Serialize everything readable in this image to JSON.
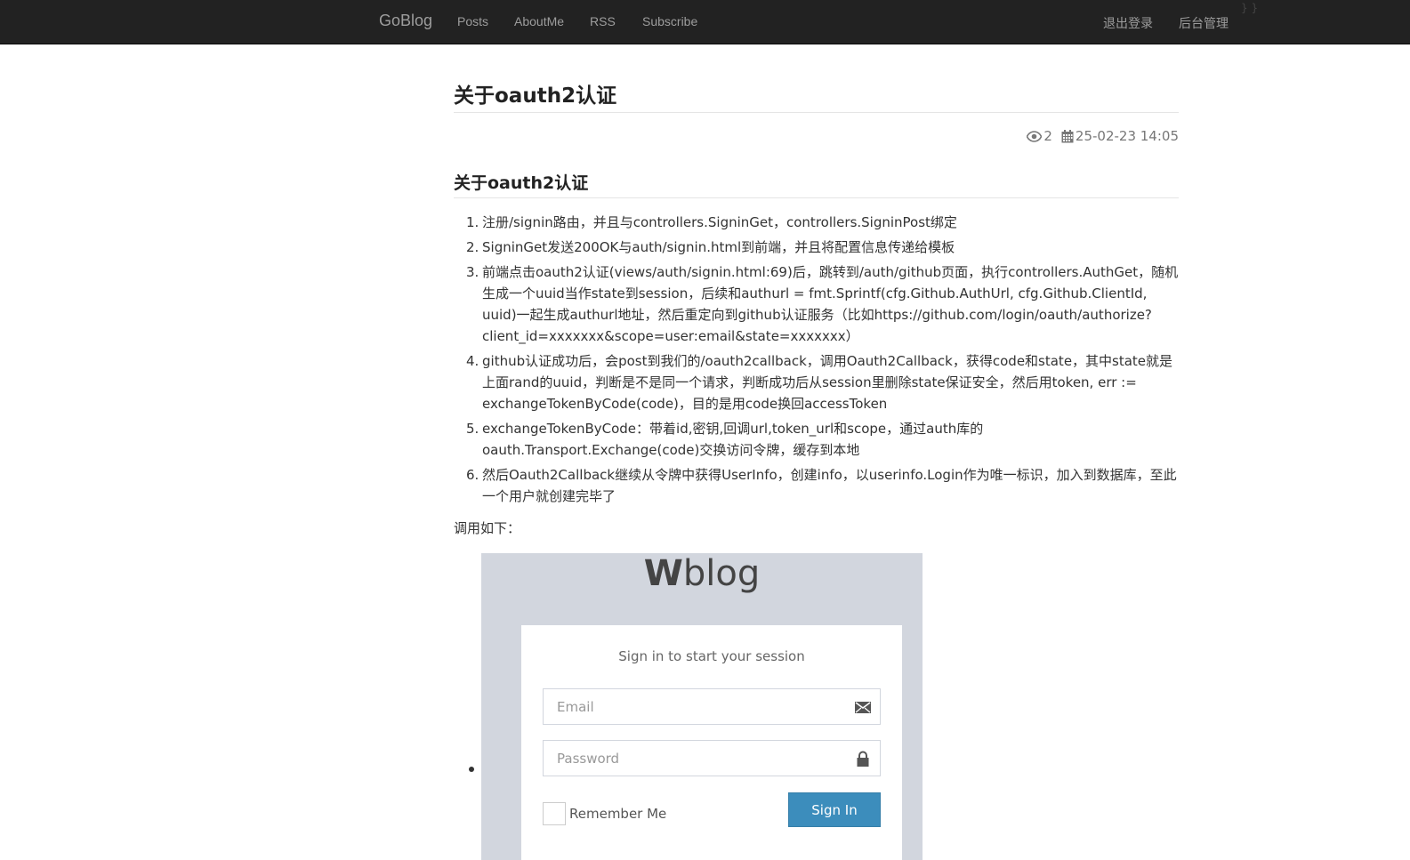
{
  "navbar": {
    "brand": "GoBlog",
    "links": [
      "Posts",
      "AboutMe",
      "RSS",
      "Subscribe"
    ],
    "right_links": [
      "退出登录",
      "后台管理"
    ],
    "ghost_text": "} }"
  },
  "post": {
    "title": "关于oauth2认证",
    "views": "2",
    "date": "25-02-23 14:05",
    "heading": "关于oauth2认证",
    "steps": [
      "注册/signin路由，并且与controllers.SigninGet，controllers.SigninPost绑定",
      "SigninGet发送200OK与auth/signin.html到前端，并且将配置信息传递给模板",
      "前端点击oauth2认证(views/auth/signin.html:69)后，跳转到/auth/github页面，执行controllers.AuthGet，随机生成一个uuid当作state到session，后续和authurl = fmt.Sprintf(cfg.Github.AuthUrl, cfg.Github.ClientId, uuid)一起生成authurl地址，然后重定向到github认证服务（比如https://github.com/login/oauth/authorize?client_id=xxxxxxx&scope=user:email&state=xxxxxxx）",
      "github认证成功后，会post到我们的/oauth2callback，调用Oauth2Callback，获得code和state，其中state就是上面rand的uuid，判断是不是同一个请求，判断成功后从session里删除state保证安全，然后用token, err := exchangeTokenByCode(code)，目的是用code换回accessToken",
      "exchangeTokenByCode：带着id,密钥,回调url,token_url和scope，通过auth库的oauth.Transport.Exchange(code)交换访问令牌，缓存到本地",
      "然后Oauth2Callback继续从令牌中获得UserInfo，创建info，以userinfo.Login作为唯一标识，加入到数据库，至此一个用户就创建完毕了"
    ],
    "call_label": "调用如下："
  },
  "login_screenshot": {
    "logo_bold": "W",
    "logo_light": "blog",
    "message": "Sign in to start your session",
    "email_placeholder": "Email",
    "password_placeholder": "Password",
    "remember_label": "Remember Me",
    "signin_label": "Sign In",
    "accent_color": "#3c8dbc"
  }
}
